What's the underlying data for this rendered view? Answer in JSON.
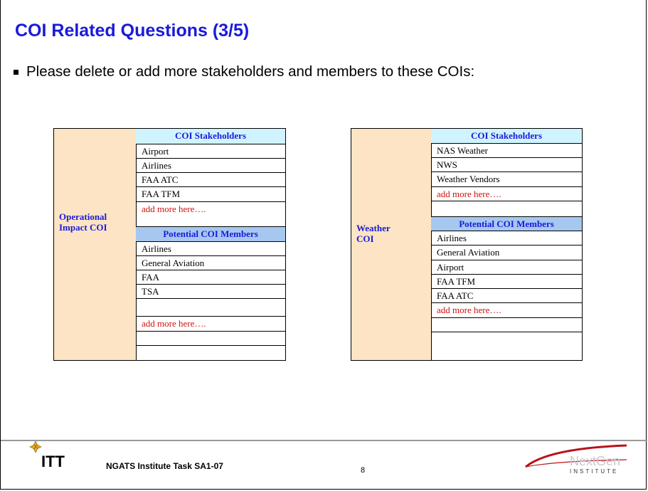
{
  "slide": {
    "title": "COI Related Questions (3/5)",
    "bullet": "Please delete or add more stakeholders and members to these COIs:"
  },
  "tables": [
    {
      "coi_name": "Operational Impact COI",
      "stakeholders_header": "COI Stakeholders",
      "stakeholders": [
        "Airport",
        "Airlines",
        "FAA ATC",
        " FAA TFM",
        "add more here…."
      ],
      "members_header": "Potential COI Members",
      "members": [
        "Airlines",
        "General Aviation",
        "FAA",
        "TSA",
        "",
        "add more here….",
        "",
        ""
      ]
    },
    {
      "coi_name": "Weather COI",
      "stakeholders_header": "COI Stakeholders",
      "stakeholders": [
        "NAS Weather",
        "NWS",
        "Weather Vendors",
        " add more here….",
        ""
      ],
      "members_header": "Potential COI Members",
      "members": [
        "Airlines",
        "General Aviation",
        "Airport",
        "FAA TFM",
        "FAA ATC",
        "add more here….",
        "",
        ""
      ]
    }
  ],
  "footer": {
    "logo_left": "ITT",
    "task": "NGATS Institute Task SA1-07",
    "page": "8",
    "logo_right": "NextGen",
    "logo_right_sub": "INSTITUTE"
  },
  "colors": {
    "title": "#1a1ad8",
    "coi_name_bg": "#fce4c4",
    "stakeholder_header_bg": "#cff4ff",
    "member_header_bg": "#a6c8f0",
    "add_more": "#d21010"
  }
}
